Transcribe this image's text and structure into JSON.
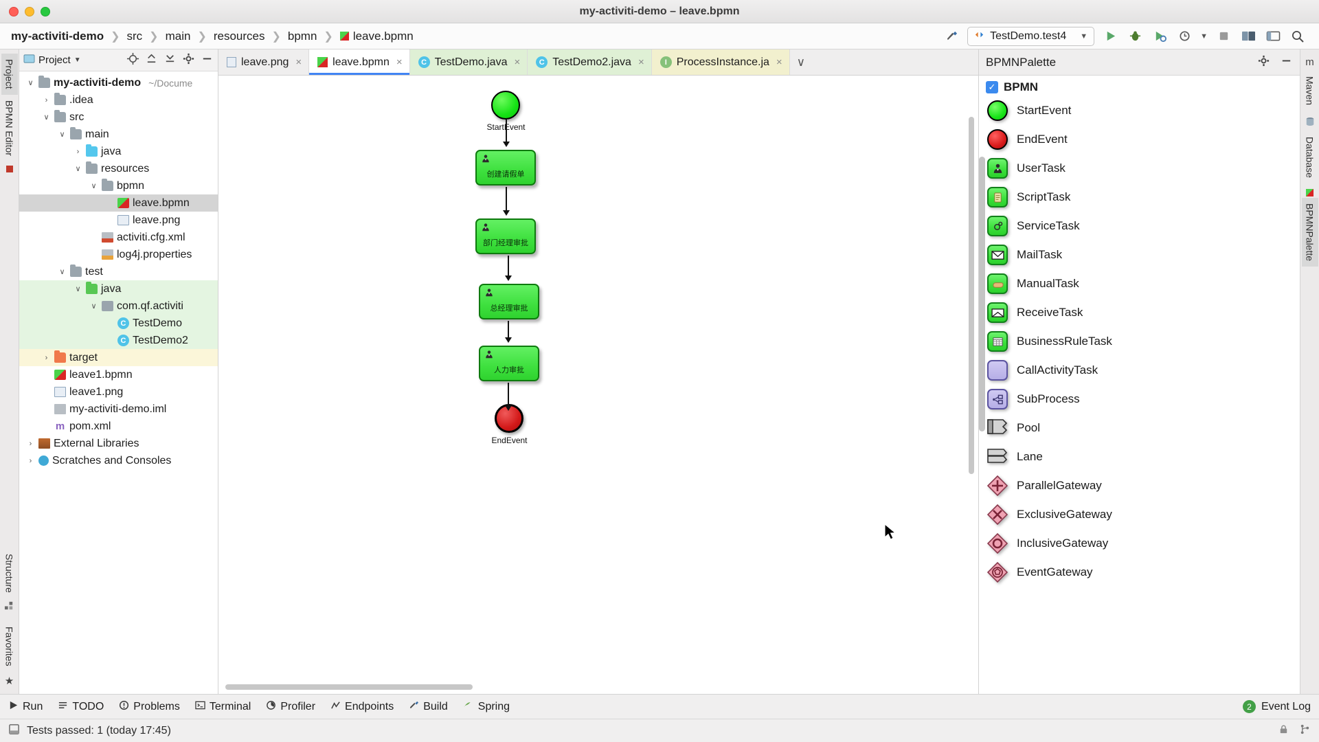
{
  "window": {
    "title": "my-activiti-demo – leave.bpmn"
  },
  "breadcrumb": {
    "items": [
      "my-activiti-demo",
      "src",
      "main",
      "resources",
      "bpmn",
      "leave.bpmn"
    ],
    "separator": "❯"
  },
  "navbar_right": {
    "hammer_icon": "build-icon",
    "run_config": "TestDemo.test4",
    "run_label": "run-icon",
    "debug_label": "debug-icon",
    "coverage_label": "coverage-icon",
    "profile_label": "profile-icon",
    "stop_label": "stop-icon",
    "services_label": "services-icon",
    "layout_label": "layout-icon",
    "search_label": "search-icon"
  },
  "left_strip": {
    "tabs": [
      "Project",
      "BPMN Editor",
      "Structure",
      "Favorites"
    ]
  },
  "right_strip": {
    "tabs": [
      "Maven",
      "Database",
      "BPMNPalette"
    ]
  },
  "project_panel": {
    "title": "Project",
    "tree": [
      {
        "label": "my-activiti-demo",
        "hint": "~/Docume",
        "depth": 0,
        "arrow": "∨",
        "icon": "module-folder",
        "bold": true
      },
      {
        "label": ".idea",
        "depth": 1,
        "arrow": "›",
        "icon": "folder"
      },
      {
        "label": "src",
        "depth": 1,
        "arrow": "∨",
        "icon": "folder"
      },
      {
        "label": "main",
        "depth": 2,
        "arrow": "∨",
        "icon": "folder"
      },
      {
        "label": "java",
        "depth": 3,
        "arrow": "›",
        "icon": "folder-blue"
      },
      {
        "label": "resources",
        "depth": 3,
        "arrow": "∨",
        "icon": "folder-resources"
      },
      {
        "label": "bpmn",
        "depth": 4,
        "arrow": "∨",
        "icon": "folder"
      },
      {
        "label": "leave.bpmn",
        "depth": 5,
        "arrow": "",
        "icon": "bpmn-file",
        "selected": true
      },
      {
        "label": "leave.png",
        "depth": 5,
        "arrow": "",
        "icon": "png-file"
      },
      {
        "label": "activiti.cfg.xml",
        "depth": 4,
        "arrow": "",
        "icon": "xml-file"
      },
      {
        "label": "log4j.properties",
        "depth": 4,
        "arrow": "",
        "icon": "properties-file"
      },
      {
        "label": "test",
        "depth": 2,
        "arrow": "∨",
        "icon": "folder"
      },
      {
        "label": "java",
        "depth": 3,
        "arrow": "∨",
        "icon": "folder-green",
        "bg": "green"
      },
      {
        "label": "com.qf.activiti",
        "depth": 4,
        "arrow": "∨",
        "icon": "package",
        "bg": "green"
      },
      {
        "label": "TestDemo",
        "depth": 5,
        "arrow": "",
        "icon": "java-class",
        "bg": "green"
      },
      {
        "label": "TestDemo2",
        "depth": 5,
        "arrow": "",
        "icon": "java-class",
        "bg": "green"
      },
      {
        "label": "target",
        "depth": 1,
        "arrow": "›",
        "icon": "folder-orange",
        "bg": "yellow"
      },
      {
        "label": "leave1.bpmn",
        "depth": 1,
        "arrow": "",
        "icon": "bpmn-file"
      },
      {
        "label": "leave1.png",
        "depth": 1,
        "arrow": "",
        "icon": "png-file"
      },
      {
        "label": "my-activiti-demo.iml",
        "depth": 1,
        "arrow": "",
        "icon": "iml-file"
      },
      {
        "label": "pom.xml",
        "depth": 1,
        "arrow": "",
        "icon": "maven-file"
      },
      {
        "label": "External Libraries",
        "depth": 0,
        "arrow": "›",
        "icon": "library"
      },
      {
        "label": "Scratches and Consoles",
        "depth": 0,
        "arrow": "›",
        "icon": "scratches"
      }
    ]
  },
  "editor": {
    "tabs": [
      {
        "label": "leave.png",
        "icon": "png-file",
        "state": "normal"
      },
      {
        "label": "leave.bpmn",
        "icon": "bpmn-file",
        "state": "active"
      },
      {
        "label": "TestDemo.java",
        "icon": "java-class",
        "state": "green"
      },
      {
        "label": "TestDemo2.java",
        "icon": "java-class",
        "state": "green"
      },
      {
        "label": "ProcessInstance.ja",
        "icon": "java-interface",
        "state": "yellow"
      }
    ],
    "overflow_icon": "chevron-down-icon"
  },
  "diagram": {
    "nodes": [
      {
        "id": "start",
        "type": "startEvent",
        "label": "StartEvent",
        "label_pos": "below"
      },
      {
        "id": "t1",
        "type": "userTask",
        "label": "创建请假单"
      },
      {
        "id": "t2",
        "type": "userTask",
        "label": "部门经理审批"
      },
      {
        "id": "t3",
        "type": "userTask",
        "label": "总经理审批"
      },
      {
        "id": "t4",
        "type": "userTask",
        "label": "人力审批"
      },
      {
        "id": "end",
        "type": "endEvent",
        "label": "EndEvent",
        "label_pos": "below"
      }
    ]
  },
  "palette": {
    "title": "BPMNPalette",
    "group_label": "BPMN",
    "group_checked": true,
    "items": [
      {
        "label": "StartEvent",
        "icon": "start-event-icon"
      },
      {
        "label": "EndEvent",
        "icon": "end-event-icon"
      },
      {
        "label": "UserTask",
        "icon": "user-task-icon"
      },
      {
        "label": "ScriptTask",
        "icon": "script-task-icon"
      },
      {
        "label": "ServiceTask",
        "icon": "service-task-icon"
      },
      {
        "label": "MailTask",
        "icon": "mail-task-icon"
      },
      {
        "label": "ManualTask",
        "icon": "manual-task-icon"
      },
      {
        "label": "ReceiveTask",
        "icon": "receive-task-icon"
      },
      {
        "label": "BusinessRuleTask",
        "icon": "business-rule-task-icon"
      },
      {
        "label": "CallActivityTask",
        "icon": "call-activity-task-icon"
      },
      {
        "label": "SubProcess",
        "icon": "sub-process-icon"
      },
      {
        "label": "Pool",
        "icon": "pool-icon"
      },
      {
        "label": "Lane",
        "icon": "lane-icon"
      },
      {
        "label": "ParallelGateway",
        "icon": "parallel-gateway-icon"
      },
      {
        "label": "ExclusiveGateway",
        "icon": "exclusive-gateway-icon"
      },
      {
        "label": "InclusiveGateway",
        "icon": "inclusive-gateway-icon"
      },
      {
        "label": "EventGateway",
        "icon": "event-gateway-icon"
      }
    ]
  },
  "bottom_bar": {
    "items": [
      {
        "label": "Run",
        "icon": "run-icon"
      },
      {
        "label": "TODO",
        "icon": "todo-icon"
      },
      {
        "label": "Problems",
        "icon": "problems-icon"
      },
      {
        "label": "Terminal",
        "icon": "terminal-icon"
      },
      {
        "label": "Profiler",
        "icon": "profiler-icon"
      },
      {
        "label": "Endpoints",
        "icon": "endpoints-icon"
      },
      {
        "label": "Build",
        "icon": "build-icon"
      },
      {
        "label": "Spring",
        "icon": "spring-icon"
      }
    ],
    "event_log": "Event Log",
    "event_log_count": "2"
  },
  "status_bar": {
    "message": "Tests passed: 1 (today 17:45)",
    "right_icons": [
      "lock-icon",
      "branch-icon"
    ]
  },
  "colors": {
    "accent": "#4285f4",
    "start_green": "#16e316",
    "end_red": "#d31919",
    "task_green": "#3ee03e",
    "selection_gray": "#d4d4d4",
    "test_green_bg": "#e4f5e1",
    "target_yellow_bg": "#fbf6d9"
  }
}
